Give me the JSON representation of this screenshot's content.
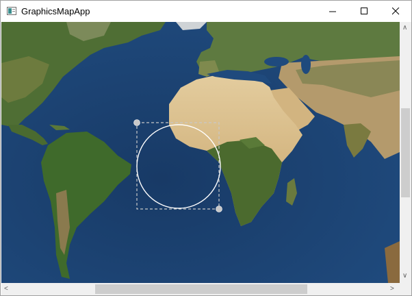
{
  "window": {
    "title": "GraphicsMapApp"
  },
  "controls": {
    "minimize": "—",
    "maximize": "☐",
    "close": "✕"
  },
  "map": {
    "ocean_color": "#1c3f6e",
    "land_green": "#4f6e34",
    "land_desert": "#d9c08f",
    "selection_circle_color": "#ffffff",
    "selection_box_color": "#c8c8c8"
  },
  "scrollbars": {
    "vertical_position": 0.39,
    "horizontal_position": 0.24
  }
}
